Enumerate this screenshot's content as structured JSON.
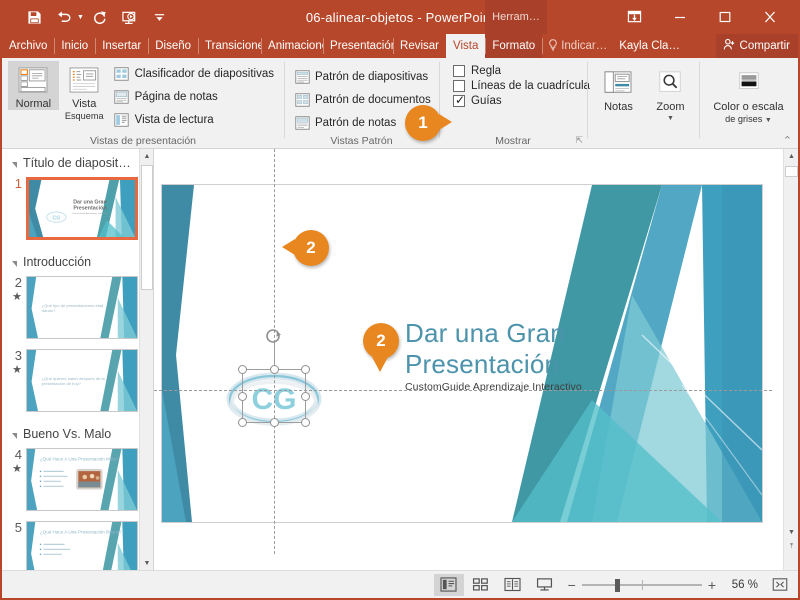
{
  "window": {
    "title": "06-alinear-objetos  -  PowerPoint",
    "contextual_tab_group": "Herram…",
    "quick_access": [
      {
        "name": "save-icon",
        "label": "Guardar"
      },
      {
        "name": "undo-icon",
        "label": "Deshacer"
      },
      {
        "name": "redo-icon",
        "label": "Rehacer"
      },
      {
        "name": "start-slideshow-icon",
        "label": "Comenzar presentación con diapositivas"
      },
      {
        "name": "customize-qat-icon",
        "label": "Personalizar barra de herramientas de acceso rápido"
      }
    ],
    "controls": [
      {
        "name": "ribbon-display-options-icon",
        "label": "Opciones de presentación de la cinta de opciones"
      },
      {
        "name": "minimize-icon",
        "label": "Minimizar"
      },
      {
        "name": "maximize-icon",
        "label": "Maximizar"
      },
      {
        "name": "close-icon",
        "label": "Cerrar"
      }
    ]
  },
  "tabs": [
    {
      "label": "Archivo",
      "active": false,
      "contextual": false
    },
    {
      "label": "Inicio",
      "active": false,
      "contextual": false
    },
    {
      "label": "Insertar",
      "active": false,
      "contextual": false
    },
    {
      "label": "Diseño",
      "active": false,
      "contextual": false
    },
    {
      "label": "Transiciones",
      "active": false,
      "contextual": false
    },
    {
      "label": "Animaciones",
      "active": false,
      "contextual": false
    },
    {
      "label": "Presentación",
      "active": false,
      "contextual": false
    },
    {
      "label": "Revisar",
      "active": false,
      "contextual": false
    },
    {
      "label": "Vista",
      "active": true,
      "contextual": false
    },
    {
      "label": "Formato",
      "active": false,
      "contextual": true
    }
  ],
  "tellme": {
    "label": "Indicar…",
    "icon": "lightbulb-icon"
  },
  "account": {
    "label": "Kayla Cla…"
  },
  "share": {
    "label": "Compartir",
    "icon": "share-person-icon"
  },
  "ribbon": {
    "groups": [
      {
        "name": "Vistas de presentación",
        "label": "Vistas de presentación",
        "big_buttons": [
          {
            "label": "Normal",
            "icon": "normal-view-icon",
            "selected": true
          },
          {
            "label": "Vista",
            "label2": "Esquema",
            "icon": "outline-view-icon",
            "selected": false
          }
        ],
        "small_buttons": [
          {
            "label": "Clasificador de diapositivas",
            "icon": "slide-sorter-icon"
          },
          {
            "label": "Página de notas",
            "icon": "notes-page-icon"
          },
          {
            "label": "Vista de lectura",
            "icon": "reading-view-icon"
          }
        ]
      },
      {
        "name": "Vistas Patrón",
        "label": "Vistas Patrón",
        "small_buttons": [
          {
            "label": "Patrón de diapositivas",
            "icon": "slide-master-icon"
          },
          {
            "label": "Patrón de documentos",
            "icon": "handout-master-icon"
          },
          {
            "label": "Patrón de notas",
            "icon": "notes-master-icon"
          }
        ]
      },
      {
        "name": "Mostrar",
        "label": "Mostrar",
        "dialog_launcher": "show-dialog-launcher",
        "checkboxes": [
          {
            "label": "Regla",
            "checked": false
          },
          {
            "label": "Líneas de la cuadrícula",
            "checked": false
          },
          {
            "label": "Guías",
            "checked": true
          }
        ]
      },
      {
        "name": "Zoom",
        "label": "",
        "big_buttons": [
          {
            "label": "Notas",
            "icon": "notes-icon",
            "selected": false
          },
          {
            "label": "Zoom",
            "icon": "zoom-magnifier-icon",
            "selected": false,
            "dropdown": true
          }
        ]
      },
      {
        "name": "Color o escala de grises",
        "label": "",
        "big_buttons": [
          {
            "label": "Color o escala",
            "label2": "de grises",
            "icon": "color-grayscale-icon",
            "selected": false,
            "dropdown": true
          }
        ]
      }
    ],
    "collapse_icon": "collapse-ribbon-icon"
  },
  "callouts": [
    {
      "number": "1",
      "target": "guias-checkbox"
    },
    {
      "number": "2",
      "target": "vertical-guide"
    },
    {
      "number": "2",
      "target": "horizontal-guide"
    }
  ],
  "slide_panel": {
    "sections": [
      {
        "title": "Título de diaposit…",
        "slides": [
          {
            "number": "1",
            "selected": true,
            "animated": false,
            "title": "Dar una Gran Presentación",
            "subtitle": "CustomGuide Aprendizaje Interactivo",
            "layout": "title"
          }
        ]
      },
      {
        "title": "Introducción",
        "slides": [
          {
            "number": "2",
            "selected": false,
            "animated": true,
            "title": "¿Qué tipo de presentaciones está dando?",
            "layout": "text"
          },
          {
            "number": "3",
            "selected": false,
            "animated": true,
            "title": "¿Qué quieres saber después de la presentación de hoy?",
            "layout": "text"
          }
        ]
      },
      {
        "title": "Bueno Vs. Malo",
        "slides": [
          {
            "number": "4",
            "selected": false,
            "animated": true,
            "title": "¿Qué Hace A Una Presentación Mala?",
            "layout": "bullets-image"
          },
          {
            "number": "5",
            "selected": false,
            "animated": false,
            "title": "¿Qué Hace A Una Presentación Buena?",
            "layout": "bullets"
          }
        ]
      }
    ]
  },
  "slide": {
    "title_line1": "Dar una Gran",
    "title_line2": "Presentación",
    "subtitle": "CustomGuide Aprendizaje Interactivo",
    "logo_text": "CG",
    "selected_object": "cg-logo-image",
    "guides_visible": true
  },
  "statusbar": {
    "view_buttons": [
      {
        "name": "normal-view-button",
        "icon": "normal-view-icon",
        "selected": true
      },
      {
        "name": "slide-sorter-button",
        "icon": "slide-sorter-icon",
        "selected": false
      },
      {
        "name": "reading-view-button",
        "icon": "reading-view-icon",
        "selected": false
      },
      {
        "name": "slideshow-button",
        "icon": "slideshow-icon",
        "selected": false
      }
    ],
    "zoom_out": "−",
    "zoom_in": "+",
    "zoom_value": "56 %",
    "fit_button": "fit-slide-to-window-icon"
  },
  "colors": {
    "brand": "#b7472a",
    "contextual": "#a8402a",
    "callout": "#e8871f",
    "slide_title": "#4c93ab",
    "teal_dark": "#3f8ba5",
    "teal_mid": "#2f8f9b",
    "teal_light": "#7ecbd6",
    "selection": "#e8683f"
  }
}
